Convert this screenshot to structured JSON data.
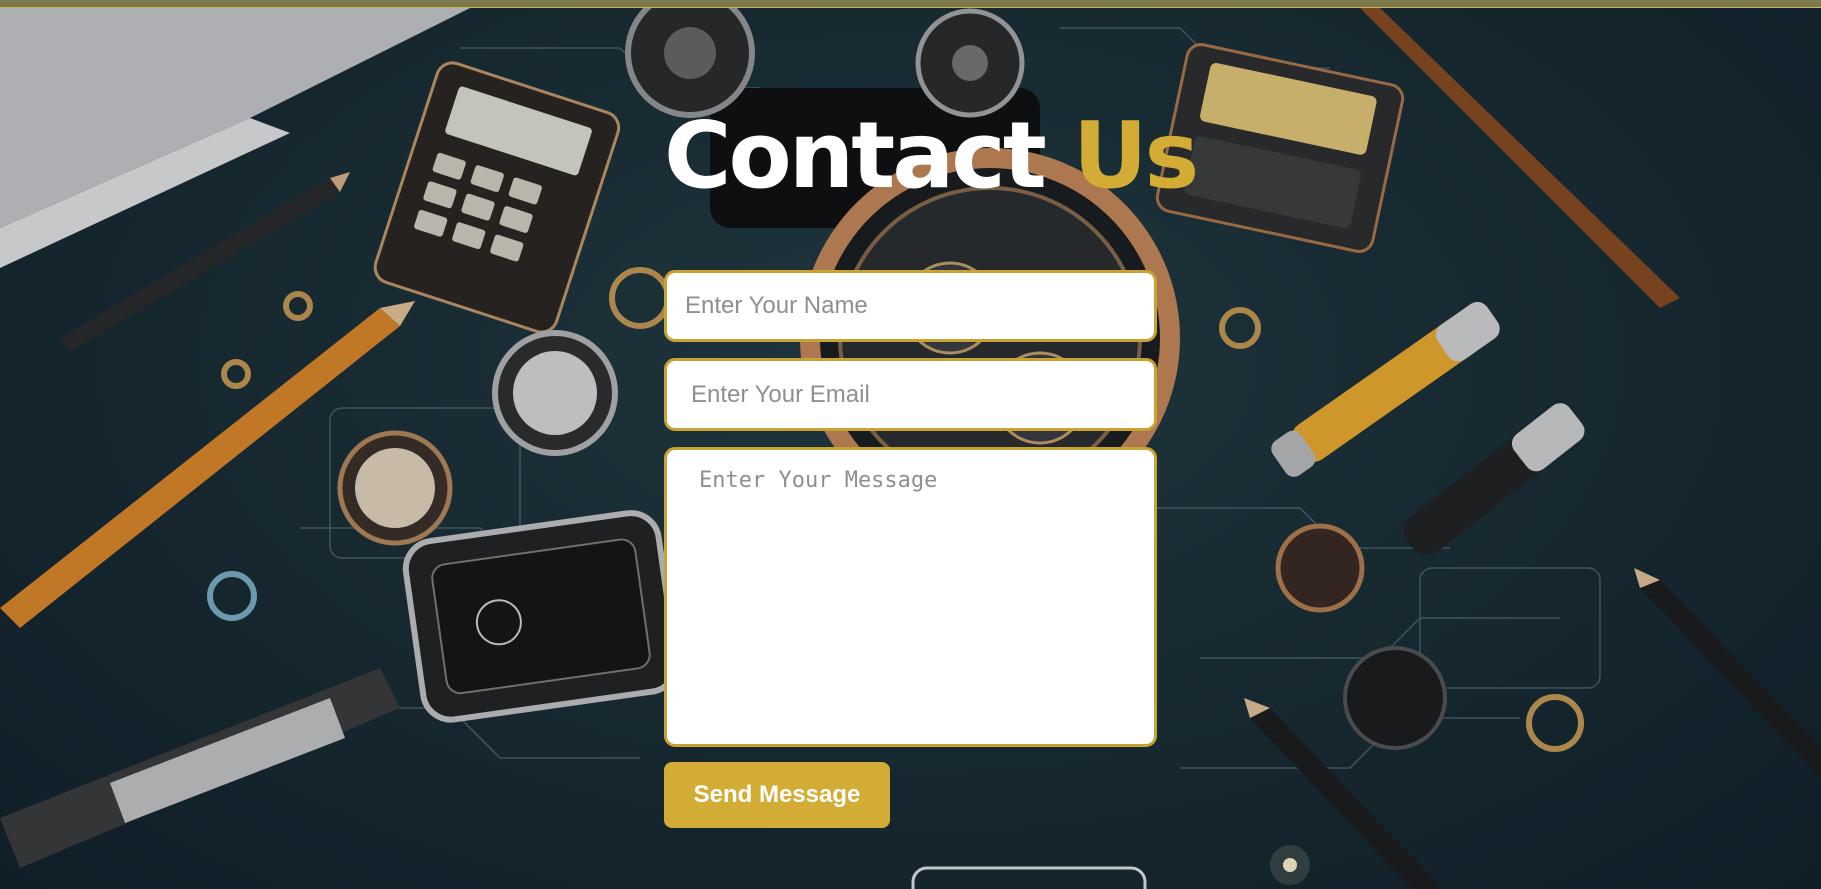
{
  "heading": {
    "part1": "Contact",
    "part2": "Us"
  },
  "form": {
    "name_placeholder": "Enter Your Name",
    "email_placeholder": "Enter Your Email",
    "message_placeholder": "Enter Your Message",
    "submit_label": "Send Message"
  },
  "colors": {
    "accent": "#d3ac35",
    "field_border": "#c8a233",
    "backdrop": "#1a2e36",
    "title_text": "#ffffff"
  }
}
